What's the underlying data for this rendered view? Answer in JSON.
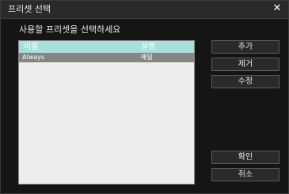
{
  "window": {
    "title": "프리셋 선택",
    "close_icon": "✕"
  },
  "dialog": {
    "prompt": "사용할 프리셋을 선택하세요"
  },
  "table": {
    "columns": {
      "name": "이름",
      "desc": "설명"
    },
    "rows": [
      {
        "name": "Always",
        "desc": "매일",
        "selected": true
      }
    ]
  },
  "buttons": {
    "add": "추가",
    "remove": "제거",
    "edit": "수정",
    "ok": "확인",
    "cancel": "취소"
  },
  "colors": {
    "header_bg": "#a7dfdd",
    "selected_row_bg": "#858585",
    "window_bg": "#151515"
  }
}
